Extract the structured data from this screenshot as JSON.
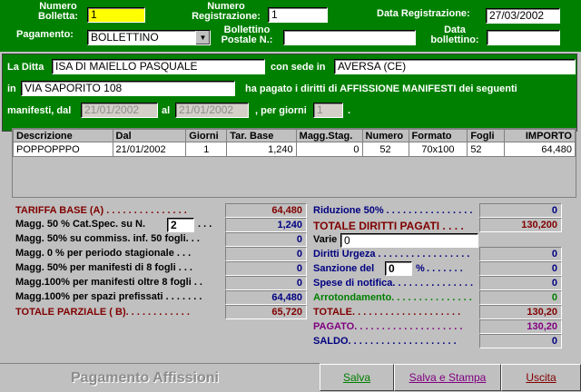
{
  "header": {
    "numero_bolletta_label": "Numero\nBolletta:",
    "numero_bolletta": "1",
    "numero_registrazione_label": "Numero\nRegistrazione:",
    "numero_registrazione": "1",
    "data_registrazione_label": "Data Registrazione:",
    "data_registrazione": "27/03/2002",
    "pagamento_label": "Pagamento:",
    "pagamento": "BOLLETTINO",
    "bollettino_postale_label": "Bollettino\nPostale N.:",
    "bollettino_postale": "",
    "data_bollettino_label": "Data\nbollettino:",
    "data_bollettino": ""
  },
  "ditta": {
    "la_ditta_label": "La Ditta",
    "ditta": "ISA DI MAIELLO PASQUALE",
    "con_sede_label": "con sede in",
    "sede": "AVERSA (CE)",
    "in_label": "in",
    "indirizzo": "VIA SAPORITO 108",
    "ha_pagato_text": "ha pagato i diritti di AFFISSIONE MANIFESTI dei seguenti",
    "manifesti_dal_label": "manifesti, dal",
    "dal": "21/01/2002",
    "al_label": "al",
    "al": "21/01/2002",
    "per_giorni_label": ", per giorni",
    "giorni": "1",
    "end_dot": "."
  },
  "grid": {
    "columns": [
      "Descrizione",
      "Dal",
      "Giorni",
      "Tar. Base",
      "Magg.Stag.",
      "Numero",
      "Formato",
      "Fogli",
      "IMPORTO"
    ],
    "rows": [
      [
        "POPPOPPPO",
        "21/01/2002",
        "1",
        "1,240",
        "0",
        "52",
        "70x100",
        "52",
        "64,480"
      ]
    ]
  },
  "left": {
    "tariffa_base_label": "TARIFFA BASE (A) . . . . . . . . . . . . . . .",
    "tariffa_base": "64,480",
    "magg50_label": "Magg. 50 % Cat.Spec. su N.",
    "magg50_n": "2",
    "magg50_dots": ". . .",
    "magg50": "1,240",
    "magg50comm_label": "Magg. 50% su commiss. inf. 50 fogli. . .",
    "magg50comm": "0",
    "magg0_label": "Magg. 0 % per periodo stagionale . . .",
    "magg0": "0",
    "magg50_8_label": "Magg. 50% per manifesti di 8 fogli . . .",
    "magg50_8": "0",
    "magg100_8_label": "Magg.100% per manifesti oltre 8 fogli . .",
    "magg100_8": "0",
    "magg100_spazi_label": "Magg.100% per spazi prefissati . . . . . . .",
    "magg100_spazi": "64,480",
    "totale_parziale_label": "TOTALE PARZIALE ( B). . . . . . . . . . . .",
    "totale_parziale": "65,720"
  },
  "right": {
    "riduzione_label": "Riduzione 50% . . . . . . . . . . . . . . . .",
    "riduzione": "0",
    "totale_diritti_label": "TOTALE DIRITTI PAGATI . . . .",
    "totale_diritti": "130,200",
    "varie_label": "Varie",
    "varie": "0",
    "diritti_urgeza_label": "Diritti Urgeza . . . . . . . . . . . . . . . . .",
    "diritti_urgeza": "0",
    "sanzione_label": "Sanzione del",
    "sanzione_pct": "0",
    "sanzione_pct_sign": "%",
    "sanzione_dots": ". . . . . . .",
    "sanzione": "0",
    "spese_label": "Spese di notifica. . . . . . . . . . . . . . .",
    "spese": "0",
    "arrotondamento_label": "Arrotondamento. . . . . . . . . . . . . . .",
    "arrotondamento": "0",
    "totale_label": "TOTALE. . . . . . . . . . . . . . . . . . . .",
    "totale": "130,20",
    "pagato_label": "PAGATO. . . . . . . . . . . . . . . . . . . .",
    "pagato": "130,20",
    "saldo_label": "SALDO. . . . . . . . . . . . . . . . . . . .",
    "saldo": "0"
  },
  "footer": {
    "title": "Pagamento Affissioni",
    "salva": "Salva",
    "salva_stampa": "Salva e Stampa",
    "uscita": "Uscita"
  },
  "colors": {
    "green": "#008000",
    "maroon": "#800000",
    "purple": "#800080",
    "dark_green": "#008000",
    "navy": "#000080"
  }
}
